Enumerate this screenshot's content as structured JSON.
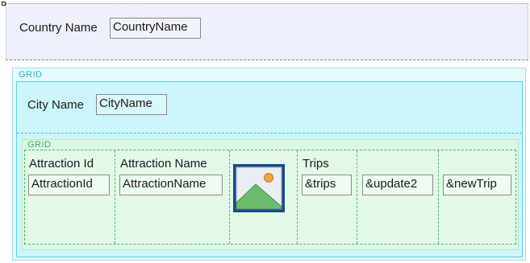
{
  "country": {
    "label": "Country Name",
    "field": "CountryName"
  },
  "outer_grid": {
    "caption": "GRID",
    "city": {
      "label": "City Name",
      "field": "CityName"
    },
    "inner_grid": {
      "caption": "GRID",
      "columns": {
        "attraction_id": {
          "label": "Attraction Id",
          "field": "AttractionId"
        },
        "attraction_name": {
          "label": "Attraction Name",
          "field": "AttractionName"
        },
        "image": {
          "icon": "image-placeholder-icon"
        },
        "trips": {
          "label": "Trips",
          "field": "&trips"
        },
        "update": {
          "field": "&update2"
        },
        "new_trip": {
          "field": "&newTrip"
        }
      }
    }
  },
  "colors": {
    "top_panel_bg": "#eef0fb",
    "outer_grid_caption": "#1fb6c8",
    "city_box_bg": "#ccf6fb",
    "inner_grid_caption": "#34b15e",
    "inner_grid_bg": "#e3f9e8",
    "image_frame": "#1a4a8a"
  }
}
